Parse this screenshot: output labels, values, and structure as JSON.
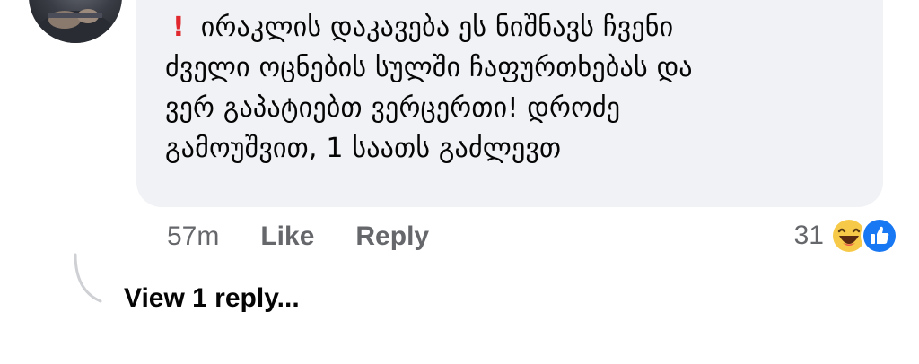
{
  "comment": {
    "text": "ირაკლის დაკავება ეს ნიშნავს ჩვენი\nძველი ოცნების სულში ჩაფურთხებას და\nვერ გაპატიებთ ვერცერთი! დროძე\nგამოუშვით, 1 საათს გაძლევთ",
    "prefix_icon": "red-exclamation-icon"
  },
  "actions": {
    "timestamp": "57m",
    "like_label": "Like",
    "reply_label": "Reply"
  },
  "reactions": {
    "count": "31",
    "icons": [
      "haha-emoji-icon",
      "like-thumb-icon"
    ],
    "like_color": "#1877f2",
    "haha_color": "#f7c948"
  },
  "replies": {
    "view_label": "View 1 reply..."
  },
  "colors": {
    "bubble_bg": "#f0f2f5",
    "meta_text": "#65676b",
    "primary_text": "#050505",
    "exclaim": "#e0282e"
  }
}
